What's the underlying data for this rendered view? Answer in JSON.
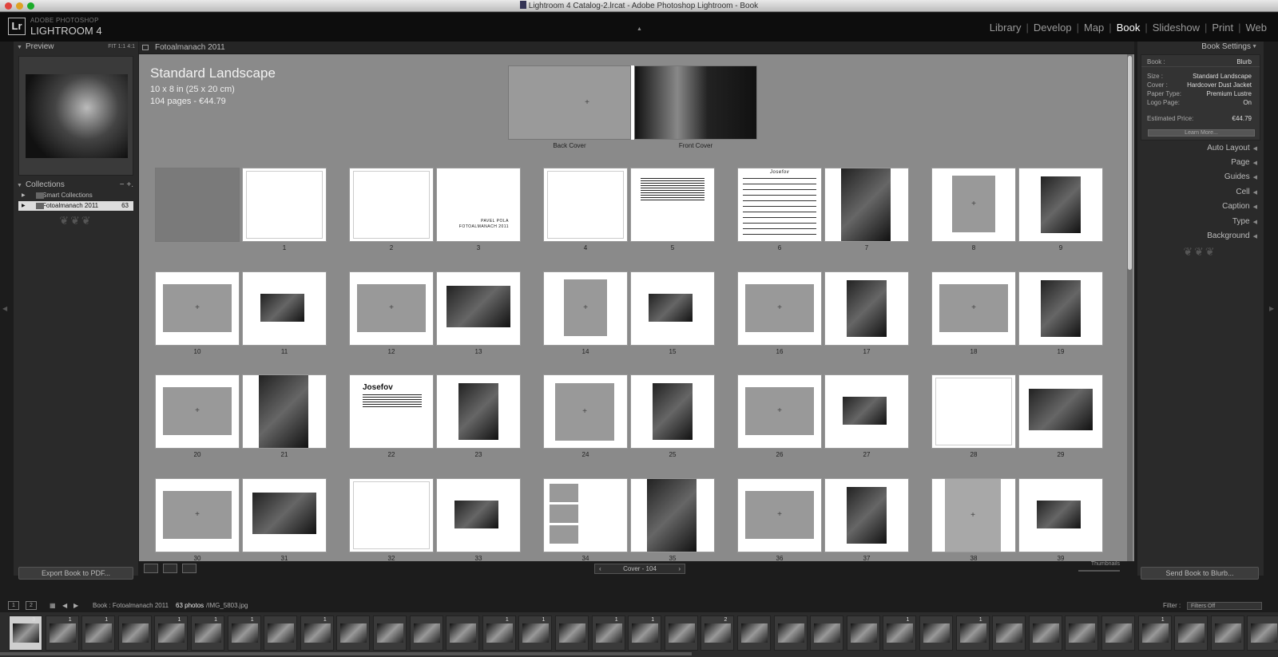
{
  "window": {
    "title": "Lightroom 4 Catalog-2.lrcat - Adobe Photoshop Lightroom - Book"
  },
  "identity": {
    "brand_small": "ADOBE PHOTOSHOP",
    "brand_big": "LIGHTROOM 4",
    "badge": "Lr"
  },
  "modules": [
    "Library",
    "Develop",
    "Map",
    "Book",
    "Slideshow",
    "Print",
    "Web"
  ],
  "left_panel": {
    "preview_title": "Preview",
    "preview_zoom": "FIT  1:1  4:1",
    "collections_title": "Collections",
    "collections_ctrls": "−  +.",
    "collections": [
      {
        "name": "Smart Collections",
        "count": ""
      },
      {
        "name": "Fotoalmanach 2011",
        "count": "63"
      }
    ],
    "export_button": "Export Book to PDF..."
  },
  "center": {
    "breadcrumb": "Fotoalmanach 2011",
    "book_title": "Standard Landscape",
    "book_size": "10 x 8 in (25 x 20 cm)",
    "book_pages": "104 pages - €44.79",
    "cover_back": "Back Cover",
    "cover_front": "Front Cover",
    "page_text_title_3": "PAVEL POLA",
    "page_text_sub_3": "FOTOALMANACH 2011",
    "page_text_title_6": "Josefov",
    "page_text_title_22": "Josefov",
    "pager": "Cover - 104",
    "thumbnails_label": "Thumbnails",
    "page_numbers": [
      "1",
      "2",
      "3",
      "4",
      "5",
      "6",
      "7",
      "8",
      "9",
      "10",
      "11",
      "12",
      "13",
      "14",
      "15",
      "16",
      "17",
      "18",
      "19",
      "20",
      "21",
      "22",
      "23",
      "24",
      "25",
      "26",
      "27",
      "28",
      "29",
      "30",
      "31",
      "32",
      "33",
      "34",
      "35",
      "36",
      "37",
      "38",
      "39"
    ]
  },
  "right_panel": {
    "book_settings_title": "Book Settings",
    "rows": [
      {
        "k": "Book :",
        "v": "Blurb"
      },
      {
        "k": "Size :",
        "v": "Standard Landscape"
      },
      {
        "k": "Cover :",
        "v": "Hardcover Dust Jacket"
      },
      {
        "k": "Paper Type:",
        "v": "Premium Lustre"
      },
      {
        "k": "Logo Page:",
        "v": "On"
      },
      {
        "k": "Estimated Price:",
        "v": "€44.79"
      }
    ],
    "learn_more": "Learn More...",
    "sections": [
      "Auto Layout",
      "Page",
      "Guides",
      "Cell",
      "Caption",
      "Type",
      "Background"
    ],
    "send_button": "Send Book to Blurb..."
  },
  "filmbar": {
    "monitor1": "1",
    "monitor2": "2",
    "source": "Book : Fotoalmanach 2011",
    "photos": "63 photos",
    "file": "/IMG_5803.jpg",
    "filter_label": "Filter :",
    "filter_value": "Filters Off"
  },
  "filmstrip_badges": [
    "3",
    "1",
    "1",
    "",
    "1",
    "1",
    "1",
    "",
    "1",
    "",
    "",
    "",
    "",
    "1",
    "1",
    "",
    "1",
    "1",
    "",
    "2",
    "",
    "",
    "",
    "",
    "1",
    "",
    "1",
    "",
    "",
    "",
    "",
    "1",
    "",
    "",
    ""
  ]
}
